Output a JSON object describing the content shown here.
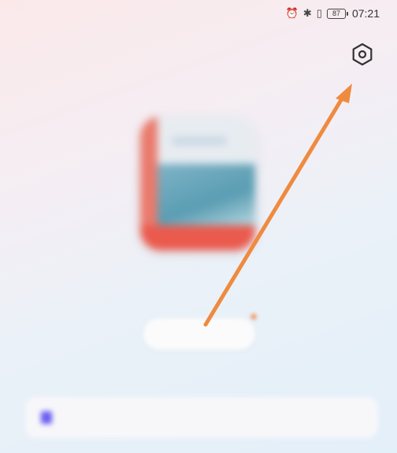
{
  "status_bar": {
    "carrier": "",
    "icons": [
      "alarm-icon",
      "bluetooth-icon",
      "vibrate-icon",
      "battery-icon"
    ],
    "battery_level": "87",
    "time": "07:21"
  },
  "header": {
    "settings_icon": "hexagon-settings-icon"
  },
  "app_card": {
    "badge_label": ""
  },
  "app": {
    "title": "",
    "action_label": ""
  },
  "bottom_bar": {
    "text": "",
    "link_text": ""
  },
  "colors": {
    "arrow": "#ef8a3f",
    "accent_red": "#ea5a4d",
    "link_purple": "#6a5cf0"
  }
}
